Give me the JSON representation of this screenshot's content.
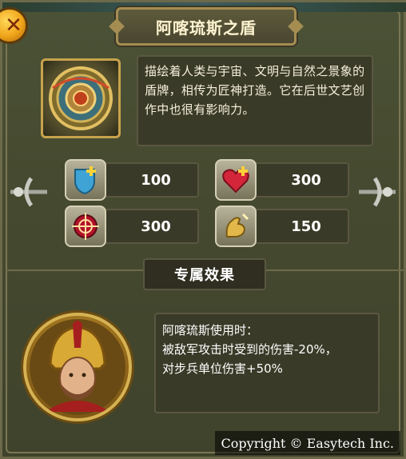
{
  "dialog": {
    "title": "阿喀琉斯之盾",
    "description": "描绘着人类与宇宙、文明与自然之景象的盾牌，相传为匠神打造。它在后世文艺创作中也很有影响力。",
    "close_icon": "close-icon"
  },
  "stats": [
    {
      "icon": "shield-plus-icon",
      "value": "100"
    },
    {
      "icon": "heart-plus-icon",
      "value": "300"
    },
    {
      "icon": "crosshair-icon",
      "value": "300"
    },
    {
      "icon": "strength-arm-icon",
      "value": "150"
    }
  ],
  "exclusive": {
    "heading": "专属效果",
    "lines": [
      "阿喀琉斯使用时：",
      "被敌军攻击时受到的伤害-20%，",
      "对步兵单位伤害+50%"
    ]
  },
  "footer": {
    "copyright": "Copyright © Easytech Inc."
  },
  "colors": {
    "panel": "#45492f",
    "gold": "#c8a34c",
    "text": "#f5f0dc"
  }
}
